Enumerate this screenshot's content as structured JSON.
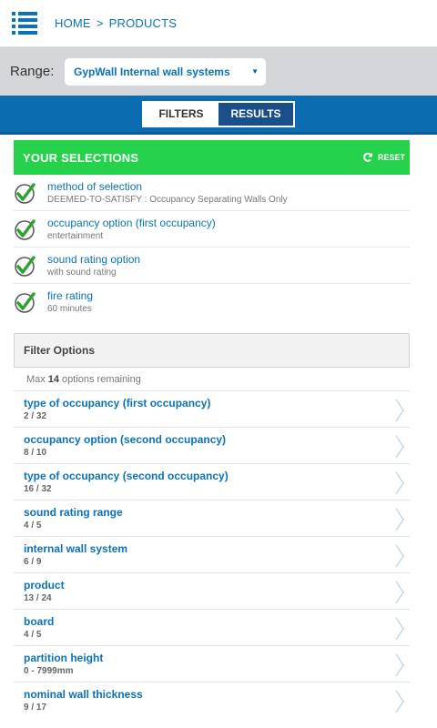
{
  "nav": {
    "menu_icon": "hamburger-list-icon",
    "breadcrumb": [
      "HOME",
      ">",
      "PRODUCTS"
    ]
  },
  "range": {
    "label": "Range:",
    "selected": "GypWall Internal wall systems",
    "caret": "▼"
  },
  "tabs": {
    "filters": "FILTERS",
    "results": "RESULTS"
  },
  "selections": {
    "title": "YOUR SELECTIONS",
    "reset_label": "RESET",
    "header_color": "#26d24c",
    "items": [
      {
        "name": "method of selection",
        "value": "DEEMED-TO-SATISFY : Occupancy Separating Walls Only"
      },
      {
        "name": "occupancy option (first occupancy)",
        "value": "entertainment"
      },
      {
        "name": "sound rating option",
        "value": "with sound rating"
      },
      {
        "name": "fire rating",
        "value": "60 minutes"
      }
    ]
  },
  "filter_options": {
    "title": "Filter Options",
    "remaining_prefix": "Max",
    "remaining_count": "14",
    "remaining_suffix": "options remaining",
    "options": [
      {
        "name": "type of occupancy (first occupancy)",
        "count": "2 / 32"
      },
      {
        "name": "occupancy option (second occupancy)",
        "count": "8 / 10"
      },
      {
        "name": "type of occupancy (second occupancy)",
        "count": "16 / 32"
      },
      {
        "name": "sound rating range",
        "count": "4 / 5"
      },
      {
        "name": "internal wall system",
        "count": "6 / 9"
      },
      {
        "name": "product",
        "count": "13 / 24"
      },
      {
        "name": "board",
        "count": "4 / 5"
      },
      {
        "name": "partition height",
        "count": "0 - 7999mm"
      },
      {
        "name": "nominal wall thickness",
        "count": "9 / 17"
      }
    ]
  },
  "colors": {
    "accent_blue": "#0b72b9",
    "tab_bar": "#0b6db0",
    "check_green": "#2fa12f"
  }
}
